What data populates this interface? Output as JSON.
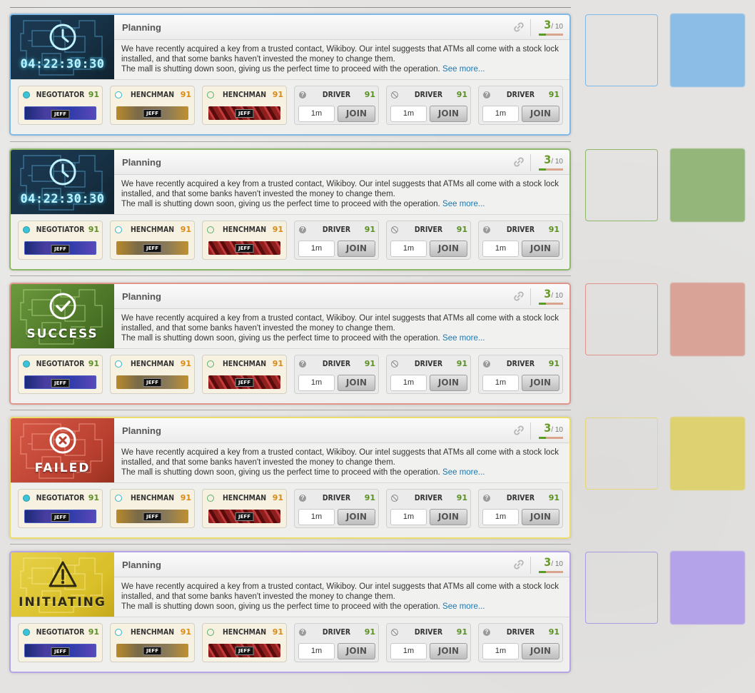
{
  "cards": [
    {
      "status": {
        "type": "timer",
        "text": "04:22:30:30",
        "icon": "clock-icon"
      },
      "header": {
        "title": "Planning",
        "link_icon": "link-icon",
        "count": "3",
        "count_total": "/ 10",
        "progress": 0.3
      },
      "description": {
        "line1": "We have recently acquired a key from a trusted contact, Wikiboy. Our intel suggests that ATMs all come with a stock lock installed, and that some banks haven't invested the money to change them.",
        "line2": "The mall is shutting down soon, giving us the perfect time to proceed with the operation.",
        "more": "See more..."
      },
      "slots": [
        {
          "role": "NEGOTIATOR",
          "level": "91",
          "player": "JEFF"
        },
        {
          "role": "HENCHMAN",
          "level": "91",
          "player": "JEFF"
        },
        {
          "role": "HENCHMAN",
          "level": "91",
          "player": "JEFF"
        },
        {
          "role": "DRIVER",
          "level": "91",
          "time": "1m",
          "join": "JOIN"
        },
        {
          "role": "DRIVER",
          "level": "91",
          "time": "1m",
          "join": "JOIN"
        },
        {
          "role": "DRIVER",
          "level": "91",
          "time": "1m",
          "join": "JOIN"
        }
      ]
    },
    {
      "status": {
        "type": "timer",
        "text": "04:22:30:30",
        "icon": "clock-icon"
      },
      "header": {
        "title": "Planning",
        "link_icon": "link-icon",
        "count": "3",
        "count_total": "/ 10",
        "progress": 0.3
      },
      "description": {
        "line1": "We have recently acquired a key from a trusted contact, Wikiboy. Our intel suggests that ATMs all come with a stock lock installed, and that some banks haven't invested the money to change them.",
        "line2": "The mall is shutting down soon, giving us the perfect time to proceed with the operation.",
        "more": "See more..."
      },
      "slots": [
        {
          "role": "NEGOTIATOR",
          "level": "91",
          "player": "JEFF"
        },
        {
          "role": "HENCHMAN",
          "level": "91",
          "player": "JEFF"
        },
        {
          "role": "HENCHMAN",
          "level": "91",
          "player": "JEFF"
        },
        {
          "role": "DRIVER",
          "level": "91",
          "time": "1m",
          "join": "JOIN"
        },
        {
          "role": "DRIVER",
          "level": "91",
          "time": "1m",
          "join": "JOIN"
        },
        {
          "role": "DRIVER",
          "level": "91",
          "time": "1m",
          "join": "JOIN"
        }
      ]
    },
    {
      "status": {
        "type": "success",
        "text": "SUCCESS",
        "icon": "check-circle-icon"
      },
      "header": {
        "title": "Planning",
        "link_icon": "link-icon",
        "count": "3",
        "count_total": "/ 10",
        "progress": 0.3
      },
      "description": {
        "line1": "We have recently acquired a key from a trusted contact, Wikiboy. Our intel suggests that ATMs all come with a stock lock installed, and that some banks haven't invested the money to change them.",
        "line2": "The mall is shutting down soon, giving us the perfect time to proceed with the operation.",
        "more": "See more..."
      },
      "slots": [
        {
          "role": "NEGOTIATOR",
          "level": "91",
          "player": "JEFF"
        },
        {
          "role": "HENCHMAN",
          "level": "91",
          "player": "JEFF"
        },
        {
          "role": "HENCHMAN",
          "level": "91",
          "player": "JEFF"
        },
        {
          "role": "DRIVER",
          "level": "91",
          "time": "1m",
          "join": "JOIN"
        },
        {
          "role": "DRIVER",
          "level": "91",
          "time": "1m",
          "join": "JOIN"
        },
        {
          "role": "DRIVER",
          "level": "91",
          "time": "1m",
          "join": "JOIN"
        }
      ]
    },
    {
      "status": {
        "type": "failed",
        "text": "FAILED",
        "icon": "x-circle-icon"
      },
      "header": {
        "title": "Planning",
        "link_icon": "link-icon",
        "count": "3",
        "count_total": "/ 10",
        "progress": 0.3
      },
      "description": {
        "line1": "We have recently acquired a key from a trusted contact, Wikiboy. Our intel suggests that ATMs all come with a stock lock installed, and that some banks haven't invested the money to change them.",
        "line2": "The mall is shutting down soon, giving us the perfect time to proceed with the operation.",
        "more": "See more..."
      },
      "slots": [
        {
          "role": "NEGOTIATOR",
          "level": "91",
          "player": "JEFF"
        },
        {
          "role": "HENCHMAN",
          "level": "91",
          "player": "JEFF"
        },
        {
          "role": "HENCHMAN",
          "level": "91",
          "player": "JEFF"
        },
        {
          "role": "DRIVER",
          "level": "91",
          "time": "1m",
          "join": "JOIN"
        },
        {
          "role": "DRIVER",
          "level": "91",
          "time": "1m",
          "join": "JOIN"
        },
        {
          "role": "DRIVER",
          "level": "91",
          "time": "1m",
          "join": "JOIN"
        }
      ]
    },
    {
      "status": {
        "type": "init",
        "text": "INITIATING",
        "icon": "warning-icon"
      },
      "header": {
        "title": "Planning",
        "link_icon": "link-icon",
        "count": "3",
        "count_total": "/ 10",
        "progress": 0.3
      },
      "description": {
        "line1": "We have recently acquired a key from a trusted contact, Wikiboy. Our intel suggests that ATMs all come with a stock lock installed, and that some banks haven't invested the money to change them.",
        "line2": "The mall is shutting down soon, giving us the perfect time to proceed with the operation.",
        "more": "See more..."
      },
      "slots": [
        {
          "role": "NEGOTIATOR",
          "level": "91",
          "player": "JEFF"
        },
        {
          "role": "HENCHMAN",
          "level": "91",
          "player": "JEFF"
        },
        {
          "role": "HENCHMAN",
          "level": "91",
          "player": "JEFF"
        },
        {
          "role": "DRIVER",
          "level": "91",
          "time": "1m",
          "join": "JOIN"
        },
        {
          "role": "DRIVER",
          "level": "91",
          "time": "1m",
          "join": "JOIN"
        },
        {
          "role": "DRIVER",
          "level": "91",
          "time": "1m",
          "join": "JOIN"
        }
      ]
    }
  ],
  "colors": {
    "card_borders": [
      "#7fb8e4",
      "#8db86a",
      "#e0958a",
      "#ecdc6a",
      "#b7a4e6"
    ],
    "swatch_outline": [
      "#7fb8e4",
      "#8db86a",
      "#e0958a",
      "#e4d77a",
      "#aa9ae0"
    ],
    "swatch_solid": [
      "#8bbde6",
      "#95b67a",
      "#d9a397",
      "#ddd171",
      "#b5a3e9"
    ],
    "level_green": "#5a9022",
    "level_orange": "#d88a17",
    "link": "#2277aa"
  }
}
